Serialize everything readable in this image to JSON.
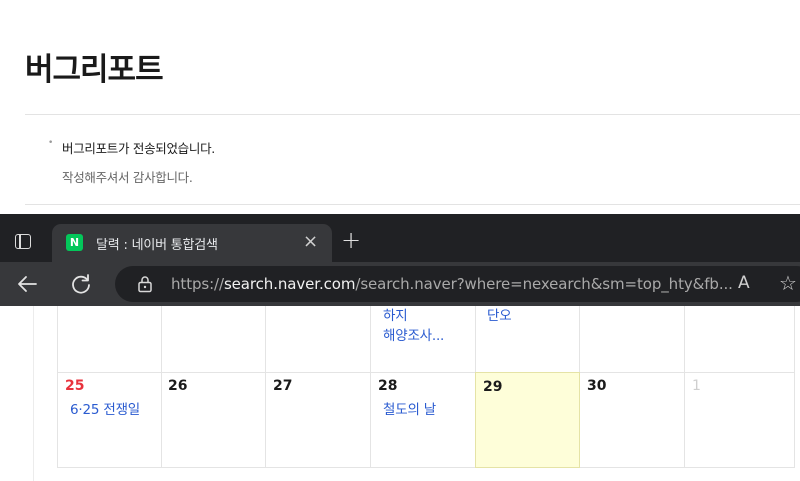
{
  "report": {
    "title": "버그리포트",
    "message": "버그리포트가 전송되었습니다.",
    "thanks": "작성해주셔서 감사합니다."
  },
  "browser": {
    "tab": {
      "favicon_letter": "N",
      "title": "달력 : 네이버 통합검색",
      "close_symbol": "×"
    },
    "new_tab_symbol": "+",
    "address": {
      "scheme": "https://",
      "host": "search.naver.com",
      "path": "/search.naver?where=nexearch&sm=top_hty&fb..."
    },
    "read_aloud_symbol": "A",
    "favorite_symbol": "☆"
  },
  "calendar": {
    "top_row_events": [
      {
        "col": 3,
        "lines": [
          "하지",
          "해양조사..."
        ]
      },
      {
        "col": 4,
        "lines": [
          "단오"
        ]
      }
    ],
    "week": [
      {
        "day": "25",
        "type": "sun",
        "event": "6·25 전쟁일"
      },
      {
        "day": "26",
        "type": "normal",
        "event": ""
      },
      {
        "day": "27",
        "type": "normal",
        "event": ""
      },
      {
        "day": "28",
        "type": "normal",
        "event": "철도의 날"
      },
      {
        "day": "29",
        "type": "today",
        "event": ""
      },
      {
        "day": "30",
        "type": "normal",
        "event": ""
      },
      {
        "day": "1",
        "type": "next",
        "event": ""
      }
    ],
    "colors": {
      "sunday": "#e8323c",
      "event": "#2a5bd0",
      "today_bg": "#fefed9"
    }
  },
  "icons": {
    "tab_actions": "tab-actions-icon",
    "back": "arrow-left-icon",
    "reload": "reload-icon",
    "lock": "lock-icon",
    "read_aloud": "read-aloud-icon",
    "favorite": "star-icon"
  }
}
